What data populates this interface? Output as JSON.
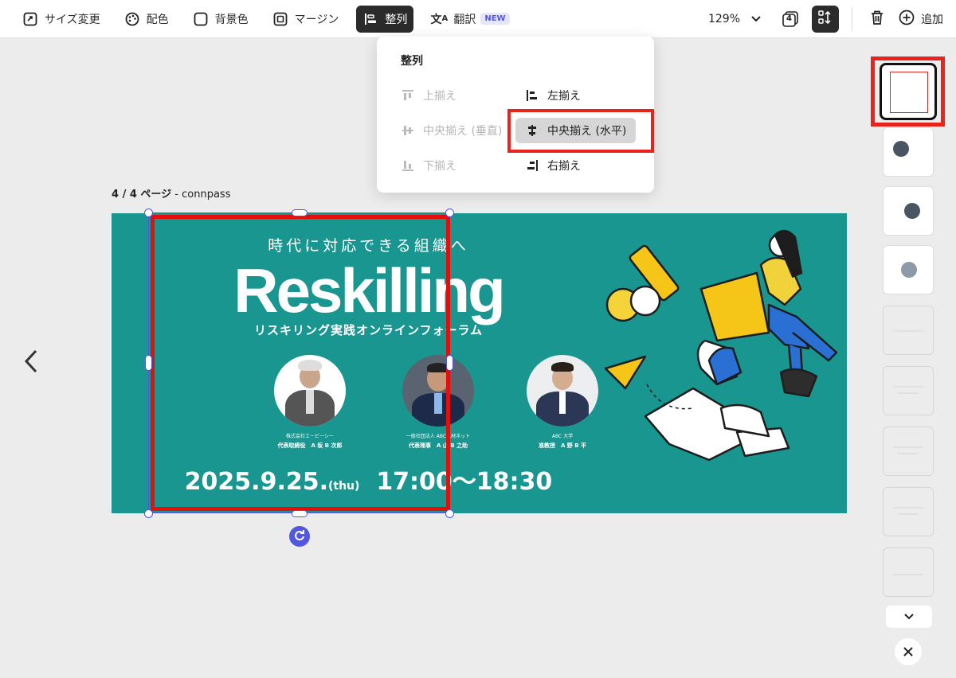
{
  "toolbar": {
    "resize": "サイズ変更",
    "colors": "配色",
    "background": "背景色",
    "margin": "マージン",
    "align": "整列",
    "translate": "翻訳",
    "new_badge": "NEW",
    "zoom": "129%",
    "layers_count": "4",
    "add": "追加"
  },
  "dropdown": {
    "title": "整列",
    "top": "上揃え",
    "middle_v": "中央揃え (垂直)",
    "bottom": "下揃え",
    "left": "左揃え",
    "center_h": "中央揃え (水平)",
    "right": "右揃え"
  },
  "canvas": {
    "page_label_bold": "4 / 4 ページ",
    "page_label_rest": " - connpass"
  },
  "banner": {
    "subtitle": "時代に対応できる組織へ",
    "title": "Reskilling",
    "subtitle2": "リスキリング実践オンラインフォーラム",
    "date": "2025.9.25.",
    "dow": "(thu)",
    "time": "17:00〜18:30",
    "speakers": [
      {
        "org": "株式会社エービーシー",
        "name": "代表取締役　A 坂 B 次郎"
      },
      {
        "org": "一般社団法人 ABC人材ネット",
        "name": "代表理事　A 山 B 之助"
      },
      {
        "org": "ABC 大学",
        "name": "准教授　A 野 B 平"
      }
    ]
  },
  "colors": {
    "banner_bg": "#1a9691",
    "selection": "#5257e0",
    "highlight": "#e8231b"
  }
}
